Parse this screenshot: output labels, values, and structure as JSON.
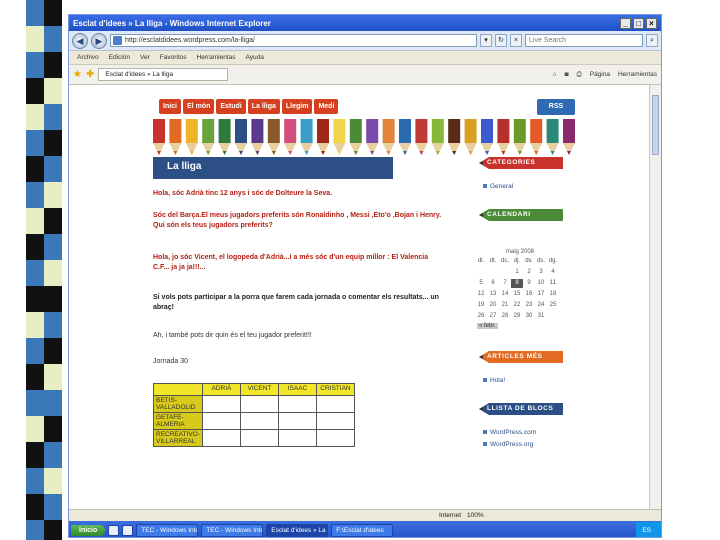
{
  "browser": {
    "title": "Esclat d'idees » La lliga - Windows Internet Explorer",
    "url": "http://esclatdidees.wordpress.com/la-lliga/",
    "search_placeholder": "Live Search",
    "menu": [
      "Archivo",
      "Edición",
      "Ver",
      "Favoritos",
      "Herramientas",
      "Ayuda"
    ],
    "tab_label": "Esclat d'idees » La lliga",
    "tools": [
      "Página",
      "Herramientas"
    ],
    "status_left": "",
    "status_zone": "Internet",
    "zoom": "100%"
  },
  "blog": {
    "nav": [
      "Inici",
      "El món",
      "Estudi",
      "La lliga",
      "Llegim",
      "Medi"
    ],
    "rss": "RSS",
    "post_title": "La lliga",
    "p1": "Hola, sóc Adrià tinc 12 anys i sóc de Dolteure la Seva.",
    "p2": "Sóc del Barça.El meus jugadors preferits són Ronaldinho , Messi ,Eto'o ,Bojan i Henry. Qui són els teus jugadors preferits?",
    "p3": "Hola, jo sóc Vicent, el logopeda d'Adrià...i a més sóc d'un equip millor : El Valencia C.F... ja ja ja!!!...",
    "p4": "Si vols pots participar a la porra que farem cada jornada o comentar els resultats... un abraç!",
    "p5": "Ah, i també pots dir quin és el teu jugador preferit!!!",
    "jornada": "Jornada 30",
    "table": {
      "headers": [
        "",
        "ADRIÀ",
        "VICENT",
        "ISAAC",
        "CRISTIAN"
      ],
      "matches": [
        "BETIS-VALLADOLID",
        "GETAFE-ALMERIA",
        "RECREATIVO-VILLARREAL"
      ]
    }
  },
  "sidebar": {
    "categories_title": "CATEGORIES",
    "categories": [
      "General"
    ],
    "calendar_title": "CALENDARI",
    "calendar_caption": "maig 2008",
    "weekdays": [
      "dl.",
      "dt.",
      "dc.",
      "dj.",
      "dv.",
      "ds.",
      "dg."
    ],
    "calendar_days": [
      "",
      "",
      "",
      "1",
      "2",
      "3",
      "4",
      "5",
      "6",
      "7",
      "8",
      "9",
      "10",
      "11",
      "12",
      "13",
      "14",
      "15",
      "16",
      "17",
      "18",
      "19",
      "20",
      "21",
      "22",
      "23",
      "24",
      "25",
      "26",
      "27",
      "28",
      "29",
      "30",
      "31",
      ""
    ],
    "today": "8",
    "calendar_prev": "« febr.",
    "articles_title": "ARTICLES MÉS",
    "articles": [
      "Hola!"
    ],
    "blogs_title": "LLISTA DE BLOCS",
    "blogs": [
      "WordPress.com",
      "WordPress.org"
    ]
  },
  "taskbar": {
    "start": "Inicio",
    "buttons": [
      "TEC - Windows Internet...",
      "TEC - Windows Internet...",
      "Esclat d'idees » La lliga...",
      "F:\\Esclat d'idees"
    ],
    "tray_lang": "ES",
    "clock": ""
  },
  "colors": {
    "nav_orange": "#d6401e",
    "header_blue": "#2c4f86",
    "sidebar_red": "#c8322a",
    "sidebar_green": "#4b8a36",
    "sidebar_orange": "#e26a22",
    "sidebar_blue": "#2c4f86",
    "table_yellow": "#f2e628"
  }
}
